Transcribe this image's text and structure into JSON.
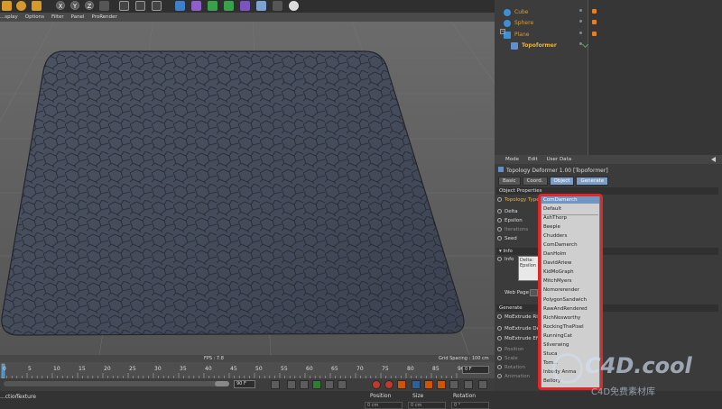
{
  "viewport_menu": [
    "...splay",
    "Options",
    "Filter",
    "Panel",
    "ProRender"
  ],
  "viewport": {
    "fps": "FPS : 7.8",
    "grid_spacing": "Grid Spacing : 100 cm"
  },
  "timeline": {
    "ticks": [
      "0",
      "5",
      "10",
      "15",
      "20",
      "25",
      "30",
      "35",
      "40",
      "45",
      "50",
      "55",
      "60",
      "65",
      "70",
      "75",
      "80",
      "85",
      "90"
    ],
    "current_frame": "0 F",
    "end_frame": "90 F"
  },
  "bottom_bar": {
    "tabs": [
      "...ction",
      "Texture"
    ],
    "coord_headers": [
      "Position",
      "Size",
      "Rotation"
    ],
    "coord_values": [
      "0 cm",
      "0 cm",
      "0 °"
    ]
  },
  "object_manager": {
    "objects": [
      {
        "name": "Cube",
        "selected": false
      },
      {
        "name": "Sphere",
        "selected": false
      },
      {
        "name": "Plane",
        "selected": false
      },
      {
        "name": "Topoformer",
        "selected": true
      }
    ]
  },
  "attribute_manager": {
    "menu": [
      "Mode",
      "Edit",
      "User Data"
    ],
    "title": "Topology Deformer 1.00 [Topoformer]",
    "tabs": [
      {
        "label": "Basic",
        "active": false
      },
      {
        "label": "Coord.",
        "active": false
      },
      {
        "label": "Object",
        "active": true
      },
      {
        "label": "Generate",
        "active": true
      }
    ],
    "section_object": "Object Properties",
    "props": {
      "topology_type": "Topology Type",
      "delta": "Delta",
      "epsilon": "Epsilon",
      "iterations": "Iterations",
      "seed": "Seed"
    },
    "section_info": "Info",
    "info_label": "Info",
    "info_text_1": "Delta:",
    "info_text_2": "Epsilon",
    "web_page": "Web Page",
    "section_generate": "Generate",
    "generate_props": [
      "MoExtrude Ri...",
      "MoExtrude De...",
      "MoExtrude Eff..."
    ],
    "transform_props": [
      "Position",
      "Scale",
      "Rotation",
      "Animation"
    ],
    "dropdown": {
      "selected": "ComDamerch",
      "items": [
        "Default",
        "AshThorp",
        "Beeple",
        "Chudders",
        "ComDamerch",
        "DanHolm",
        "DavidAriew",
        "KidMoGraph",
        "MitchMyers",
        "Nomorerender",
        "PolygonSandwich",
        "RawAndRendered",
        "RichNosworthy",
        "RockingThePixel",
        "RunningCat",
        "Silverwing",
        "Stuca",
        "Tom...",
        "Inbody Anma",
        "Bellory"
      ]
    }
  },
  "watermark": {
    "logo": "C4D.cool",
    "subtitle": "C4D免费素材库"
  }
}
